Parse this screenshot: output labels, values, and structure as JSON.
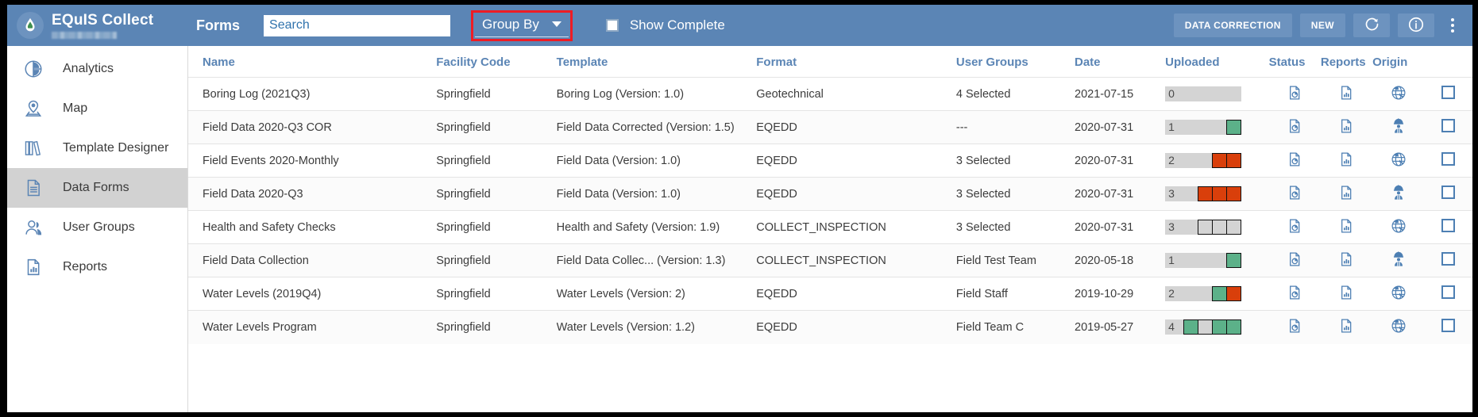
{
  "colors": {
    "appbar": "#5b85b5",
    "appbar_btn": "#6d93bf",
    "header_text": "#5b85b5",
    "annotation": "#ee1c24",
    "selected_row": "#d2d2d2",
    "progress_track": "#d4d4d4",
    "progress_green": "#5cb189",
    "progress_red": "#d93f0b"
  },
  "appbar": {
    "logo_icon": "equis-drop-logo-icon",
    "brand_title": "EQuIS Collect",
    "brand_subtitle_redacted": true,
    "module_title": "Forms",
    "search": {
      "placeholder": "Search",
      "value": ""
    },
    "group_by": {
      "label": "Group By",
      "icon": "chevron-down-icon",
      "annotated": true
    },
    "show_complete": {
      "label": "Show Complete",
      "checked": false
    },
    "data_correction_label": "DATA CORRECTION",
    "new_label": "NEW",
    "refresh_icon": "refresh-icon",
    "info_icon": "info-icon",
    "overflow_icon": "kebab-menu-icon"
  },
  "sidebar": {
    "items": [
      {
        "label": "Analytics",
        "icon": "pie-chart-icon",
        "selected": false
      },
      {
        "label": "Map",
        "icon": "map-pin-icon",
        "selected": false
      },
      {
        "label": "Template Designer",
        "icon": "books-icon",
        "selected": false
      },
      {
        "label": "Data Forms",
        "icon": "document-icon",
        "selected": true
      },
      {
        "label": "User Groups",
        "icon": "users-icon",
        "selected": false
      },
      {
        "label": "Reports",
        "icon": "report-chart-icon",
        "selected": false
      }
    ]
  },
  "table": {
    "columns": [
      "Name",
      "Facility Code",
      "Template",
      "Format",
      "User Groups",
      "Date",
      "Uploaded",
      "Status",
      "Reports",
      "Origin"
    ],
    "rows": [
      {
        "name": "Boring Log (2021Q3)",
        "facility": "Springfield",
        "template": "Boring Log (Version: 1.0)",
        "format": "Geotechnical",
        "user_groups": "4 Selected",
        "date": "2021-07-15",
        "uploaded": {
          "count": "0",
          "cells": []
        },
        "status_icon": "document-pie-chart-icon",
        "reports_icon": "document-bar-chart-icon",
        "origin_icon": "globe-icon",
        "checked": false
      },
      {
        "name": "Field Data 2020-Q3 COR",
        "facility": "Springfield",
        "template": "Field Data Corrected (Version: 1.5)",
        "format": "EQEDD",
        "user_groups": "---",
        "date": "2020-07-31",
        "uploaded": {
          "count": "1",
          "cells": [
            "green"
          ]
        },
        "status_icon": "document-pie-chart-icon",
        "reports_icon": "document-bar-chart-icon",
        "origin_icon": "field-worker-icon",
        "checked": false
      },
      {
        "name": "Field Events 2020-Monthly",
        "facility": "Springfield",
        "template": "Field Data (Version: 1.0)",
        "format": "EQEDD",
        "user_groups": "3 Selected",
        "date": "2020-07-31",
        "uploaded": {
          "count": "2",
          "cells": [
            "red",
            "red"
          ]
        },
        "status_icon": "document-pie-chart-icon",
        "reports_icon": "document-bar-chart-icon",
        "origin_icon": "globe-icon",
        "checked": false
      },
      {
        "name": "Field Data 2020-Q3",
        "facility": "Springfield",
        "template": "Field Data (Version: 1.0)",
        "format": "EQEDD",
        "user_groups": "3 Selected",
        "date": "2020-07-31",
        "uploaded": {
          "count": "3",
          "cells": [
            "red",
            "red",
            "red"
          ]
        },
        "status_icon": "document-pie-chart-icon",
        "reports_icon": "document-bar-chart-icon",
        "origin_icon": "field-worker-icon",
        "checked": false
      },
      {
        "name": "Health and Safety Checks",
        "facility": "Springfield",
        "template": "Health and Safety (Version: 1.9)",
        "format": "COLLECT_INSPECTION",
        "user_groups": "3 Selected",
        "date": "2020-07-31",
        "uploaded": {
          "count": "3",
          "cells": [
            "gray",
            "gray",
            "gray"
          ]
        },
        "status_icon": "document-pie-chart-icon",
        "reports_icon": "document-bar-chart-icon",
        "origin_icon": "globe-icon",
        "checked": false
      },
      {
        "name": "Field Data Collection",
        "facility": "Springfield",
        "template": "Field Data Collec... (Version: 1.3)",
        "format": "COLLECT_INSPECTION",
        "user_groups": "Field Test Team",
        "date": "2020-05-18",
        "uploaded": {
          "count": "1",
          "cells": [
            "green"
          ]
        },
        "status_icon": "document-pie-chart-icon",
        "reports_icon": "document-bar-chart-icon",
        "origin_icon": "field-worker-icon",
        "checked": false
      },
      {
        "name": "Water Levels (2019Q4)",
        "facility": "Springfield",
        "template": "Water Levels (Version: 2)",
        "format": "EQEDD",
        "user_groups": "Field Staff",
        "date": "2019-10-29",
        "uploaded": {
          "count": "2",
          "cells": [
            "green",
            "red"
          ]
        },
        "status_icon": "document-pie-chart-icon",
        "reports_icon": "document-bar-chart-icon",
        "origin_icon": "globe-icon",
        "checked": false
      },
      {
        "name": "Water Levels Program",
        "facility": "Springfield",
        "template": "Water Levels (Version: 1.2)",
        "format": "EQEDD",
        "user_groups": "Field Team C",
        "date": "2019-05-27",
        "uploaded": {
          "count": "4",
          "cells": [
            "green",
            "gray",
            "green",
            "green"
          ]
        },
        "status_icon": "document-pie-chart-icon",
        "reports_icon": "document-bar-chart-icon",
        "origin_icon": "globe-icon",
        "checked": false
      }
    ]
  }
}
